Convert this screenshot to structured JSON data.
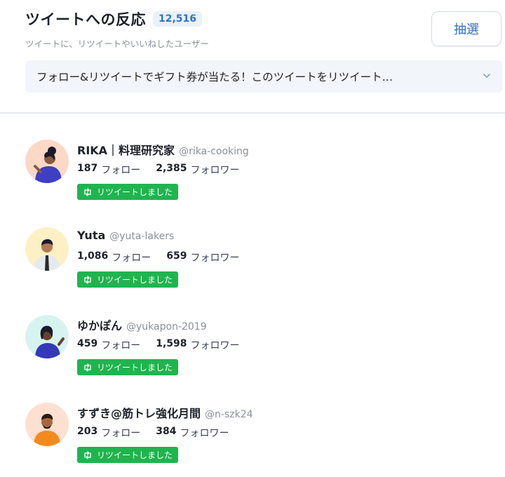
{
  "header": {
    "title": "ツイートへの反応",
    "count": "12,516",
    "subtitle": "ツイートに、リツイートやいいねしたユーザー",
    "draw_button": "抽選",
    "tweet_select": "フォロー&リツイートでギフト券が当たる！このツイートをリツイート…"
  },
  "users": [
    {
      "name": "RIKA｜料理研究家",
      "handle": "@rika-cooking",
      "follows": "187",
      "follows_label": "フォロー",
      "followers": "2,385",
      "followers_label": "フォロワー",
      "badge": "リツイートしました"
    },
    {
      "name": "Yuta",
      "handle": "@yuta-lakers",
      "follows": "1,086",
      "follows_label": "フォロー",
      "followers": "659",
      "followers_label": "フォロワー",
      "badge": "リツイートしました"
    },
    {
      "name": "ゆかぽん",
      "handle": "@yukapon-2019",
      "follows": "459",
      "follows_label": "フォロー",
      "followers": "1,598",
      "followers_label": "フォロワー",
      "badge": "リツイートしました"
    },
    {
      "name": "すずき@筋トレ強化月間",
      "handle": "@n-szk24",
      "follows": "203",
      "follows_label": "フォロー",
      "followers": "384",
      "followers_label": "フォロワー",
      "badge": "リツイートしました"
    }
  ],
  "colors": {
    "accent": "#2f74c9",
    "badge_green": "#1fb44f"
  }
}
